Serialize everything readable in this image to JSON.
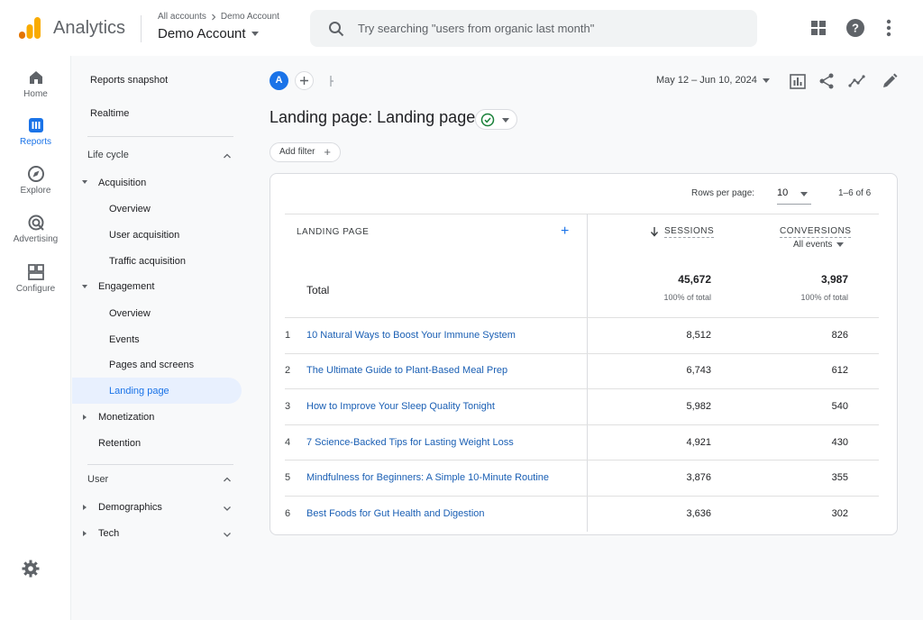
{
  "app": {
    "name": "Analytics",
    "logo_icon": "analytics-bars-icon"
  },
  "breadcrumb": {
    "parent": "All accounts",
    "current": "Demo Account"
  },
  "account": {
    "name": "Demo Account"
  },
  "search": {
    "placeholder": "Try searching \"users from organic last month\""
  },
  "top_icons": [
    "apps-grid-icon",
    "help-icon",
    "more-vert-icon"
  ],
  "rail": [
    {
      "label": "Home",
      "icon": "home-icon"
    },
    {
      "label": "Reports",
      "icon": "reports-icon",
      "active": true
    },
    {
      "label": "Explore",
      "icon": "explore-icon"
    },
    {
      "label": "Advertising",
      "icon": "advertising-icon"
    },
    {
      "label": "Configure",
      "icon": "configure-icon"
    }
  ],
  "sidebar": {
    "reports_snapshot": "Reports snapshot",
    "realtime": "Realtime",
    "lifecycle": "Life cycle",
    "acquisition": "Acquisition",
    "acq_overview": "Overview",
    "user_acquisition": "User acquisition",
    "traffic_acquisition": "Traffic acquisition",
    "engagement": "Engagement",
    "eng_overview": "Overview",
    "events": "Events",
    "pages_screens": "Pages and screens",
    "landing_page": "Landing page",
    "monetization": "Monetization",
    "retention": "Retention",
    "user": "User",
    "demographics": "Demographics",
    "tech": "Tech"
  },
  "toolbar": {
    "avatar_letter": "A",
    "date_range": "May 12 – Jun 10, 2024"
  },
  "page": {
    "title": "Landing page: Landing page",
    "add_filter": "Add filter"
  },
  "table": {
    "rows_per_page_label": "Rows per page:",
    "rows_per_page": "10",
    "range": "1–6 of 6",
    "col_dimension": "LANDING PAGE",
    "col_sessions": "SESSIONS",
    "col_conversions": "CONVERSIONS",
    "conversions_sub": "All events",
    "total_label": "Total",
    "total_sessions": "45,672",
    "total_sessions_pct": "100% of total",
    "total_conversions": "3,987",
    "total_conversions_pct": "100% of total",
    "rows": [
      {
        "n": "1",
        "page": "10 Natural Ways to Boost Your Immune System",
        "sessions": "8,512",
        "conversions": "826"
      },
      {
        "n": "2",
        "page": "The Ultimate Guide to Plant-Based Meal Prep",
        "sessions": "6,743",
        "conversions": "612"
      },
      {
        "n": "3",
        "page": "How to Improve Your Sleep Quality Tonight",
        "sessions": "5,982",
        "conversions": "540"
      },
      {
        "n": "4",
        "page": "7 Science-Backed Tips for Lasting Weight Loss",
        "sessions": "4,921",
        "conversions": "430"
      },
      {
        "n": "5",
        "page": "Mindfulness for Beginners: A Simple 10-Minute Routine",
        "sessions": "3,876",
        "conversions": "355"
      },
      {
        "n": "6",
        "page": "Best Foods for Gut Health and Digestion",
        "sessions": "3,636",
        "conversions": "302"
      }
    ]
  },
  "colors": {
    "accent": "#1a73e8",
    "link": "#1a5fb4",
    "logo_orange": "#f9ab00",
    "logo_dark": "#e37400"
  }
}
